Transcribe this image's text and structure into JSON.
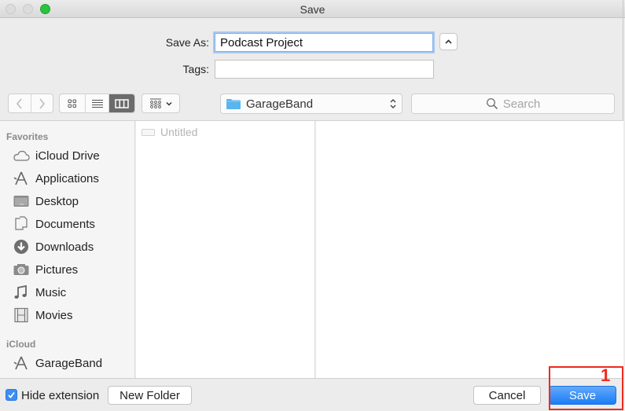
{
  "window": {
    "title": "Save",
    "traffic_lights": [
      "close",
      "minimize",
      "zoom"
    ]
  },
  "form": {
    "save_as_label": "Save As:",
    "save_as_value": "Podcast Project",
    "tags_label": "Tags:",
    "tags_value": "",
    "collapse_icon": "chevron-up-icon"
  },
  "toolbar": {
    "back_icon": "chevron-left-icon",
    "forward_icon": "chevron-right-icon",
    "view_modes": [
      {
        "name": "icon-view",
        "active": false
      },
      {
        "name": "list-view",
        "active": false
      },
      {
        "name": "column-view",
        "active": true
      }
    ],
    "group_menu_icon": "group-by-icon",
    "location": "GarageBand",
    "search_placeholder": "Search"
  },
  "sidebar": {
    "sections": [
      {
        "title": "Favorites",
        "items": [
          {
            "label": "iCloud Drive",
            "icon": "cloud-icon"
          },
          {
            "label": "Applications",
            "icon": "applications-icon"
          },
          {
            "label": "Desktop",
            "icon": "desktop-icon"
          },
          {
            "label": "Documents",
            "icon": "documents-icon"
          },
          {
            "label": "Downloads",
            "icon": "downloads-icon"
          },
          {
            "label": "Pictures",
            "icon": "camera-icon"
          },
          {
            "label": "Music",
            "icon": "music-note-icon"
          },
          {
            "label": "Movies",
            "icon": "film-icon"
          }
        ]
      },
      {
        "title": "iCloud",
        "items": [
          {
            "label": "GarageBand",
            "icon": "applications-icon"
          }
        ]
      }
    ]
  },
  "browser": {
    "column1": [
      {
        "label": "Untitled",
        "disabled": true
      }
    ]
  },
  "footer": {
    "hide_extension_label": "Hide extension",
    "hide_extension_checked": true,
    "new_folder_label": "New Folder",
    "cancel_label": "Cancel",
    "save_label": "Save"
  },
  "annotation": {
    "step_number": "1",
    "color": "#ef2a1f"
  },
  "colors": {
    "accent": "#1a7ef5",
    "focus_ring": "#a9c9f1",
    "folder": "#5ab4ef"
  }
}
